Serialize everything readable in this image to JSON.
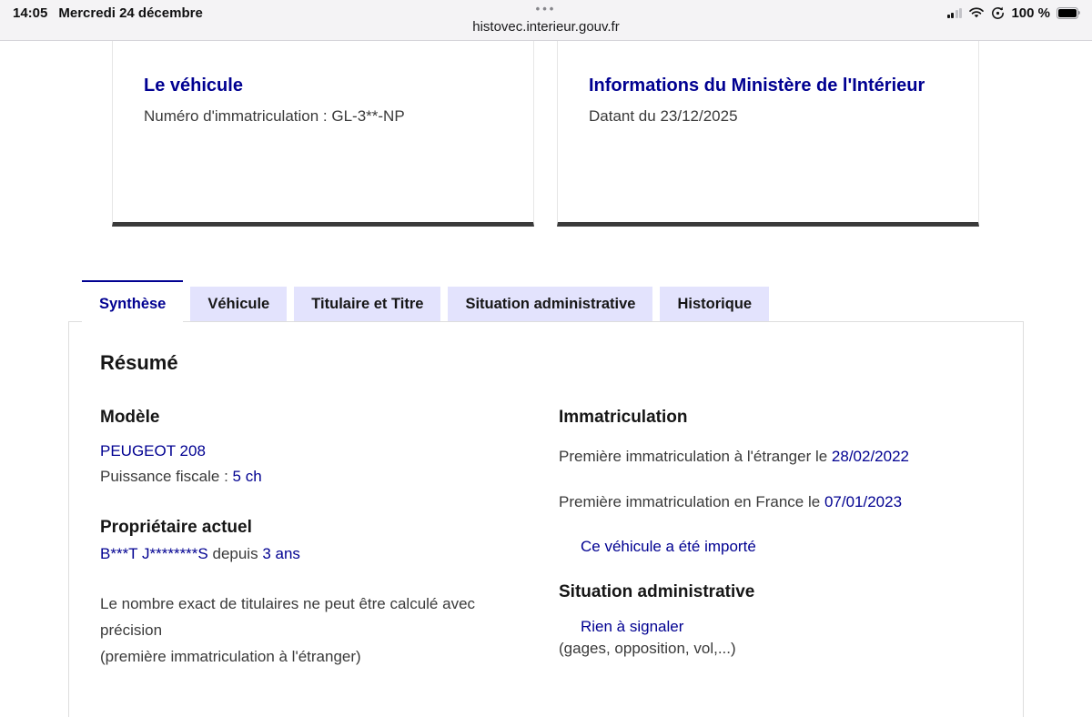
{
  "status_bar": {
    "time": "14:05",
    "date": "Mercredi 24 décembre",
    "tab_dots": "•••",
    "url": "histovec.interieur.gouv.fr",
    "battery_percent": "100 %",
    "icons": {
      "signal": "cellular-signal-2-of-4",
      "wifi": "wifi-icon",
      "rotation_lock": "rotation-lock-icon",
      "battery": "battery-full-icon"
    }
  },
  "cards": [
    {
      "title": "Le véhicule",
      "body": "Numéro d'immatriculation : GL-3**-NP"
    },
    {
      "title": "Informations du Ministère de l'Intérieur",
      "body": "Datant du 23/12/2025"
    }
  ],
  "tabs": [
    {
      "label": "Synthèse",
      "active": true
    },
    {
      "label": "Véhicule",
      "active": false
    },
    {
      "label": "Titulaire et Titre",
      "active": false
    },
    {
      "label": "Situation administrative",
      "active": false
    },
    {
      "label": "Historique",
      "active": false
    }
  ],
  "panel": {
    "heading": "Résumé",
    "model": {
      "heading": "Modèle",
      "name": "PEUGEOT 208",
      "power_label": "Puissance fiscale : ",
      "power_value": "5 ch"
    },
    "owner": {
      "heading": "Propriétaire actuel",
      "name": "B***T J********S",
      "since_label": " depuis ",
      "since_value": "3 ans",
      "note_line1": "Le nombre exact de titulaires ne peut être calculé avec précision",
      "note_line2": "(première immatriculation à l'étranger)"
    },
    "registration": {
      "heading": "Immatriculation",
      "foreign_label": "Première immatriculation à l'étranger le ",
      "foreign_date": "28/02/2022",
      "france_label": "Première immatriculation en France le ",
      "france_date": "07/01/2023",
      "imported": "Ce véhicule a été importé"
    },
    "situation": {
      "heading": "Situation administrative",
      "status": "Rien à signaler",
      "note": "(gages, opposition, vol,...)"
    }
  },
  "colors": {
    "accent_blue": "#000091",
    "tab_inactive_bg": "#e3e3fd",
    "body_text": "#3a3a3a",
    "card_bottom_border": "#3a3a3a"
  }
}
